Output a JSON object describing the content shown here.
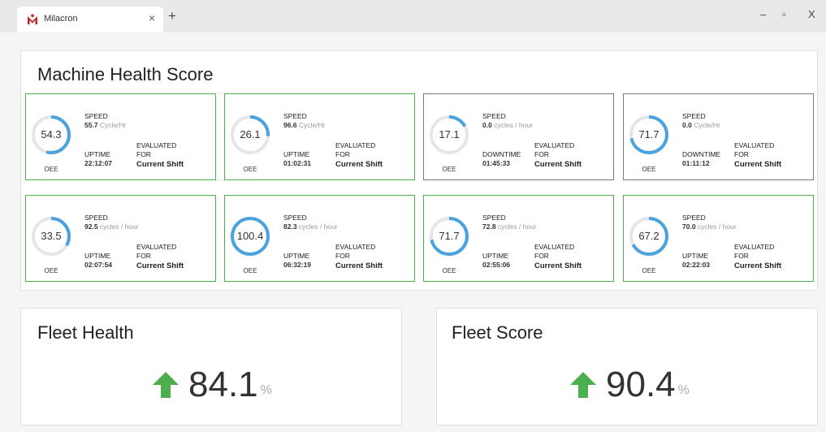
{
  "window": {
    "tab_title": "Milacron",
    "tab_close": "×",
    "new_tab": "+",
    "minimize": "–",
    "restore": "▫",
    "close": "X"
  },
  "machine_health": {
    "title": "Machine Health Score",
    "cards": [
      {
        "oee": "54.3",
        "oee_fraction": 0.543,
        "oee_label": "OEE",
        "speed_label": "SPEED",
        "speed_value": "55.7",
        "speed_unit": "Cycle/Hr",
        "time_label": "UPTIME",
        "time_value": "22:12:07",
        "evaluated_label": "EVALUATED",
        "for_label": "FOR",
        "shift": "Current Shift",
        "status": "green"
      },
      {
        "oee": "26.1",
        "oee_fraction": 0.261,
        "oee_label": "OEE",
        "speed_label": "SPEED",
        "speed_value": "96.6",
        "speed_unit": "Cycle/Hr",
        "time_label": "UPTIME",
        "time_value": "01:02:31",
        "evaluated_label": "EVALUATED",
        "for_label": "FOR",
        "shift": "Current Shift",
        "status": "green"
      },
      {
        "oee": "17.1",
        "oee_fraction": 0.171,
        "oee_label": "OEE",
        "speed_label": "SPEED",
        "speed_value": "0.0",
        "speed_unit": "cycles / hour",
        "time_label": "DOWNTIME",
        "time_value": "01:45:33",
        "evaluated_label": "EVALUATED",
        "for_label": "FOR",
        "shift": "Current Shift",
        "status": "gray"
      },
      {
        "oee": "71.7",
        "oee_fraction": 0.717,
        "oee_label": "OEE",
        "speed_label": "SPEED",
        "speed_value": "0.0",
        "speed_unit": "Cycle/Hr",
        "time_label": "DOWNTIME",
        "time_value": "01:11:12",
        "evaluated_label": "EVALUATED",
        "for_label": "FOR",
        "shift": "Current Shift",
        "status": "gray"
      },
      {
        "oee": "33.5",
        "oee_fraction": 0.335,
        "oee_label": "OEE",
        "speed_label": "SPEED",
        "speed_value": "92.5",
        "speed_unit": "cycles / hour",
        "time_label": "UPTIME",
        "time_value": "02:07:54",
        "evaluated_label": "EVALUATED",
        "for_label": "FOR",
        "shift": "Current Shift",
        "status": "green"
      },
      {
        "oee": "100.4",
        "oee_fraction": 1.0,
        "oee_label": "OEE",
        "speed_label": "SPEED",
        "speed_value": "82.3",
        "speed_unit": "cycles / hour",
        "time_label": "UPTIME",
        "time_value": "06:32:19",
        "evaluated_label": "EVALUATED",
        "for_label": "FOR",
        "shift": "Current Shift",
        "status": "green"
      },
      {
        "oee": "71.7",
        "oee_fraction": 0.717,
        "oee_label": "OEE",
        "speed_label": "SPEED",
        "speed_value": "72.8",
        "speed_unit": "cycles / hour",
        "time_label": "UPTIME",
        "time_value": "02:55:06",
        "evaluated_label": "EVALUATED",
        "for_label": "FOR",
        "shift": "Current Shift",
        "status": "green"
      },
      {
        "oee": "67.2",
        "oee_fraction": 0.672,
        "oee_label": "OEE",
        "speed_label": "SPEED",
        "speed_value": "70.0",
        "speed_unit": "cycles / hour",
        "time_label": "UPTIME",
        "time_value": "02:22:03",
        "evaluated_label": "EVALUATED",
        "for_label": "FOR",
        "shift": "Current Shift",
        "status": "green"
      }
    ]
  },
  "fleet_health": {
    "title": "Fleet Health",
    "value": "84.1",
    "unit": "%",
    "trend": "up-arrow-icon"
  },
  "fleet_score": {
    "title": "Fleet Score",
    "value": "90.4",
    "unit": "%",
    "trend": "up-arrow-icon"
  },
  "colors": {
    "gauge_fill": "#4aa3df",
    "gauge_track": "#e6e6e6",
    "card_ok_border": "#4cae4c",
    "card_idle_border": "#7a7a7a",
    "arrow": "#4cae4c",
    "logo": "#c0282e"
  }
}
